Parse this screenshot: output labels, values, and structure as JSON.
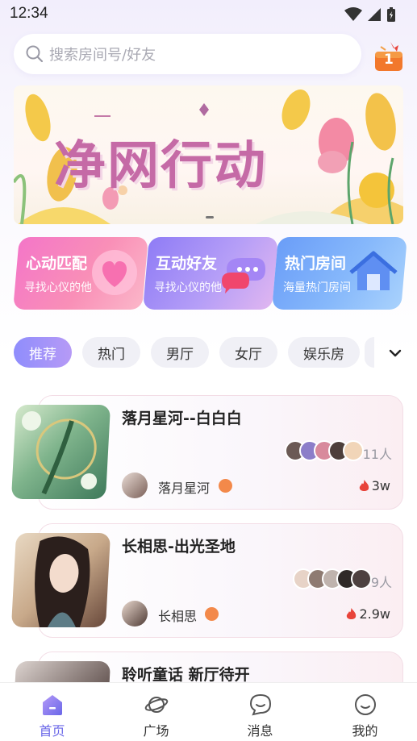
{
  "status_bar": {
    "time": "12:34"
  },
  "search": {
    "placeholder": "搜索房间号/好友"
  },
  "gift_badge": {
    "count": "1"
  },
  "banner": {
    "title": "净网行动"
  },
  "features": [
    {
      "title": "心动匹配",
      "subtitle": "寻找心仪的他"
    },
    {
      "title": "互动好友",
      "subtitle": "寻找心仪的他"
    },
    {
      "title": "热门房间",
      "subtitle": "海量热门房间"
    }
  ],
  "tabs": [
    "推荐",
    "热门",
    "男厅",
    "女厅",
    "娱乐房"
  ],
  "rooms": [
    {
      "title": "落月星河--白白白",
      "count": "11人",
      "host": "落月星河",
      "heat": "3w"
    },
    {
      "title": "长相思-出光圣地",
      "count": "9人",
      "host": "长相思",
      "heat": "2.9w"
    },
    {
      "title": "聆听童话 新厅待开",
      "count": "",
      "host": "",
      "heat": ""
    }
  ],
  "nav": [
    {
      "label": "首页"
    },
    {
      "label": "广场"
    },
    {
      "label": "消息"
    },
    {
      "label": "我的"
    }
  ],
  "colors": {
    "accent": "#6a67e8",
    "tab_active_start": "#8f8dfc",
    "tab_active_end": "#b69af6",
    "heat": "#e8433a"
  }
}
